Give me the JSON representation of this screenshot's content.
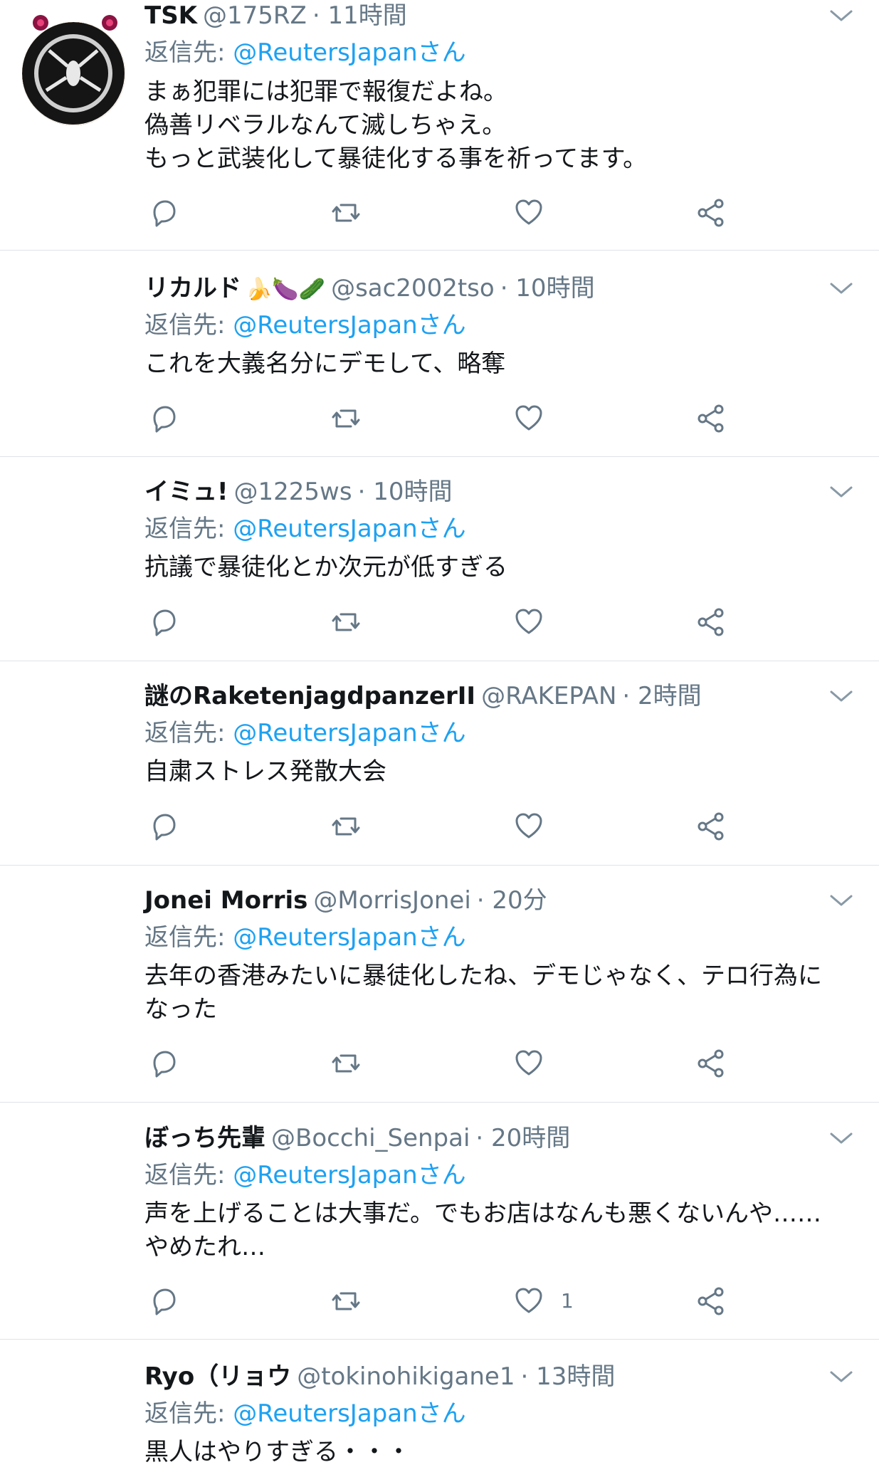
{
  "colors": {
    "accent": "#1da1f2",
    "secondary": "#657786",
    "text": "#14171a",
    "divider": "#dfe3e8"
  },
  "icons": {
    "reply": "reply-icon",
    "retweet": "retweet-icon",
    "like": "heart-icon",
    "share": "share-icon",
    "menu": "chevron-down-icon"
  },
  "tweets": [
    {
      "name": "TSK",
      "handle": "@175RZ",
      "time": "· 11時間",
      "reply_prefix": "返信先:",
      "reply_to": "@ReutersJapanさん",
      "text": "まぁ犯罪には犯罪で報復だよね。\n偽善リベラルなんて滅しちゃえ。\nもっと武装化して暴徒化する事を祈ってます。",
      "like_count": ""
    },
    {
      "name": "リカルド",
      "name_emojis": "🍌🍆🥒",
      "handle": "@sac2002tso",
      "time": "· 10時間",
      "reply_prefix": "返信先:",
      "reply_to": "@ReutersJapanさん",
      "text": "これを大義名分にデモして、略奪",
      "like_count": ""
    },
    {
      "name": "イミュ!",
      "handle": "@1225ws",
      "time": "· 10時間",
      "reply_prefix": "返信先:",
      "reply_to": "@ReutersJapanさん",
      "text": "抗議で暴徒化とか次元が低すぎる",
      "like_count": ""
    },
    {
      "name": "謎のRaketenjagdpanzerII",
      "handle": "@RAKEPAN",
      "time": "· 2時間",
      "reply_prefix": "返信先:",
      "reply_to": "@ReutersJapanさん",
      "text": "自粛ストレス発散大会",
      "like_count": ""
    },
    {
      "name": "Jonei Morris",
      "handle": "@MorrisJonei",
      "time": "· 20分",
      "reply_prefix": "返信先:",
      "reply_to": "@ReutersJapanさん",
      "text": "去年の香港みたいに暴徒化したね、デモじゃなく、テロ行為に\nなった",
      "like_count": ""
    },
    {
      "name": "ぼっち先輩",
      "handle": "@Bocchi_Senpai",
      "time": "· 20時間",
      "reply_prefix": "返信先:",
      "reply_to": "@ReutersJapanさん",
      "text": "声を上げることは大事だ。でもお店はなんも悪くないんや……\nやめたれ…",
      "like_count": "1"
    },
    {
      "name": "Ryo（リョウ",
      "handle": "@tokinohikigane1",
      "time": "· 13時間",
      "reply_prefix": "返信先:",
      "reply_to": "@ReutersJapanさん",
      "text": "黒人はやりすぎる・・・",
      "like_count": ""
    }
  ]
}
